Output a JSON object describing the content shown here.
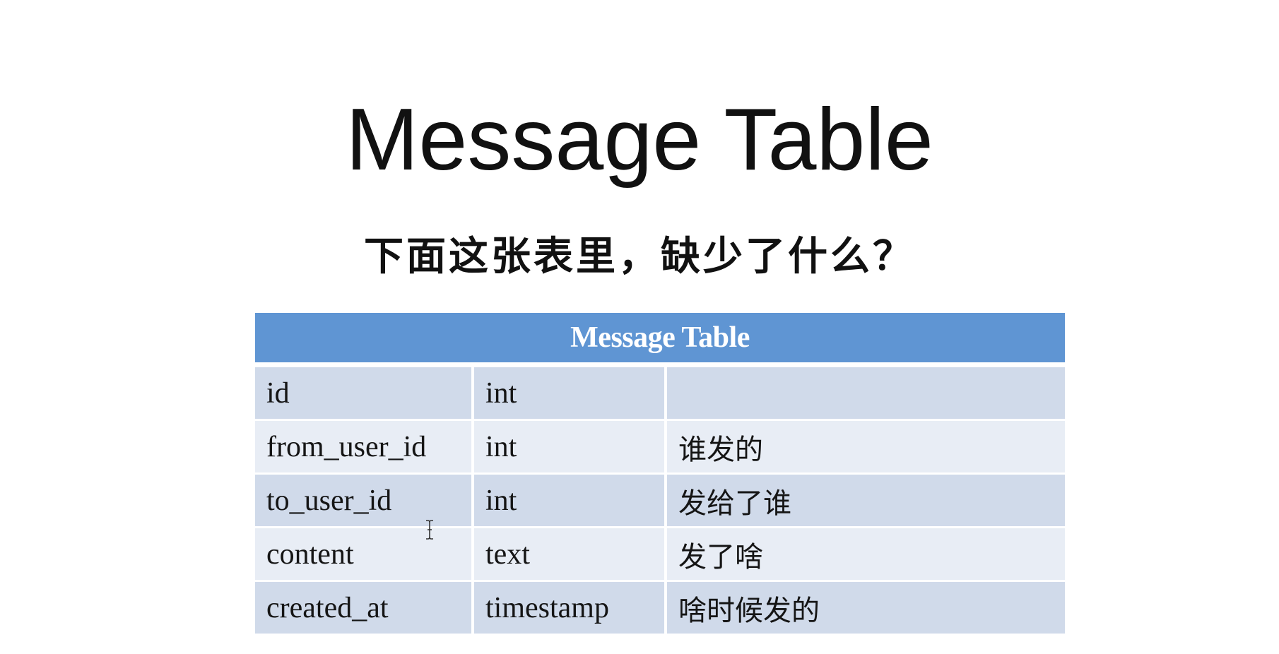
{
  "slide": {
    "title": "Message Table",
    "subtitle": "下面这张表里，缺少了什么？"
  },
  "table": {
    "caption": "Message Table",
    "header_color": "#5f95d3",
    "rows": [
      {
        "field": "id",
        "type": "int",
        "note": ""
      },
      {
        "field": "from_user_id",
        "type": "int",
        "note": "谁发的"
      },
      {
        "field": "to_user_id",
        "type": "int",
        "note": "发给了谁"
      },
      {
        "field": "content",
        "type": "text",
        "note": "发了啥"
      },
      {
        "field": "created_at",
        "type": "timestamp",
        "note": "啥时候发的"
      }
    ]
  },
  "cursor": {
    "icon": "text-cursor-icon"
  }
}
